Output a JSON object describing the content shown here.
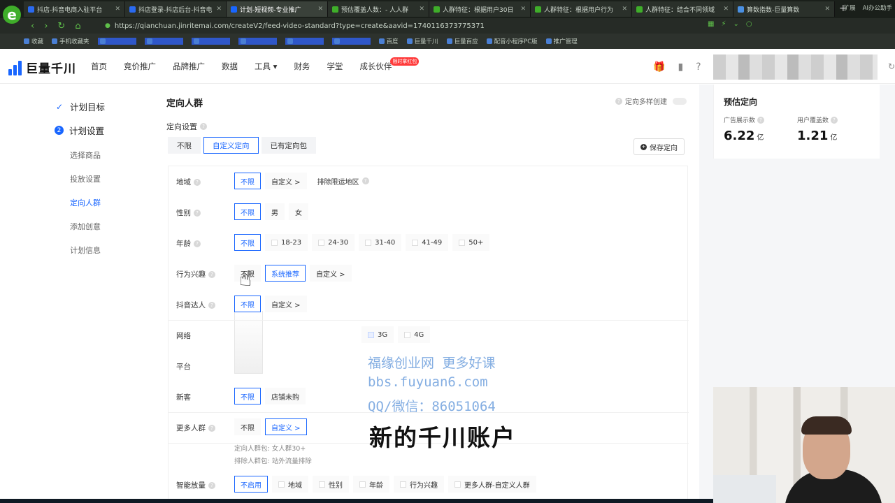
{
  "browser": {
    "tabs": [
      {
        "label": "抖店-抖音电商入驻平台",
        "color": "#2a6af0",
        "active": false
      },
      {
        "label": "抖店登录-抖店后台-抖音电",
        "color": "#2a6af0",
        "active": false
      },
      {
        "label": "计划-短视频-专业推广",
        "color": "#1966ff",
        "active": true
      },
      {
        "label": "预估覆盖人数：- 人人群",
        "color": "#3fae2a",
        "active": false
      },
      {
        "label": "人群特征：根据用户30日",
        "color": "#3fae2a",
        "active": false
      },
      {
        "label": "人群特征：根据用户行为",
        "color": "#3fae2a",
        "active": false
      },
      {
        "label": "人群特征：结合不同领域",
        "color": "#3fae2a",
        "active": false
      },
      {
        "label": "算数指数-巨量算数",
        "color": "#4a90e2",
        "active": false
      }
    ],
    "url": "https://qianchuan.jinritemai.com/createV2/feed-video-standard?type=create&aavid=1740116373775371",
    "bookmarks": [
      {
        "label": "收藏",
        "blue": false
      },
      {
        "label": "手机收藏夹",
        "blue": false
      },
      {
        "label": "",
        "blue": true
      },
      {
        "label": "",
        "blue": true
      },
      {
        "label": "",
        "blue": true
      },
      {
        "label": "",
        "blue": true
      },
      {
        "label": "",
        "blue": true
      },
      {
        "label": "",
        "blue": true
      },
      {
        "label": "百度",
        "blue": false
      },
      {
        "label": "巨量千川",
        "blue": false
      },
      {
        "label": "巨量百应",
        "blue": false
      },
      {
        "label": "配音小程序PC版",
        "blue": false
      },
      {
        "label": "推广管理",
        "blue": false
      }
    ],
    "bookmarks_right": [
      "扩展",
      "AI办公助手"
    ]
  },
  "app": {
    "brand": "巨量千川",
    "nav": [
      "首页",
      "竞价推广",
      "品牌推广",
      "数据",
      "工具 ▾",
      "财务",
      "学堂",
      "成长伙伴"
    ],
    "nav_badge": "限时拿红包"
  },
  "steps": {
    "done": "计划目标",
    "current_num": "2",
    "current": "计划设置",
    "subs": [
      {
        "label": "选择商品",
        "active": false
      },
      {
        "label": "投放设置",
        "active": false
      },
      {
        "label": "定向人群",
        "active": true
      },
      {
        "label": "添加创意",
        "active": false
      },
      {
        "label": "计划信息",
        "active": false
      }
    ]
  },
  "form": {
    "title": "定向人群",
    "multi_create": "定向多样创建",
    "setting_label": "定向设置",
    "segments": [
      {
        "label": "不限",
        "selected": false
      },
      {
        "label": "自定义定向",
        "selected": true
      },
      {
        "label": "已有定向包",
        "selected": false
      }
    ],
    "save_label": "保存定向",
    "rows": [
      {
        "label": "地域",
        "help": true,
        "options": [
          {
            "text": "不限",
            "style": "sel"
          },
          {
            "text": "自定义 >",
            "style": ""
          },
          {
            "text": "排除限运地区",
            "style": "plain",
            "help": true
          }
        ]
      },
      {
        "label": "性别",
        "help": true,
        "options": [
          {
            "text": "不限",
            "style": "sel"
          },
          {
            "text": "男",
            "style": ""
          },
          {
            "text": "女",
            "style": ""
          }
        ]
      },
      {
        "label": "年龄",
        "help": true,
        "options": [
          {
            "text": "不限",
            "style": "sel"
          },
          {
            "text": "18-23",
            "style": "cb"
          },
          {
            "text": "24-30",
            "style": "cb"
          },
          {
            "text": "31-40",
            "style": "cb"
          },
          {
            "text": "41-49",
            "style": "cb"
          },
          {
            "text": "50+",
            "style": "cb"
          }
        ]
      },
      {
        "label": "行为兴趣",
        "help": true,
        "options": [
          {
            "text": "不限",
            "style": ""
          },
          {
            "text": "系统推荐",
            "style": "bsel"
          },
          {
            "text": "自定义 >",
            "style": ""
          }
        ]
      },
      {
        "label": "抖音达人",
        "help": true,
        "options": [
          {
            "text": "不限",
            "style": "sel"
          },
          {
            "text": "自定义 >",
            "style": ""
          }
        ]
      },
      {
        "label": "网络",
        "help": false,
        "options": [
          {
            "text": "3G",
            "style": "cbon"
          },
          {
            "text": "4G",
            "style": "cb"
          }
        ]
      },
      {
        "label": "平台",
        "help": false,
        "options": []
      },
      {
        "label": "新客",
        "help": false,
        "options": [
          {
            "text": "不限",
            "style": "sel"
          },
          {
            "text": "店铺未购",
            "style": ""
          }
        ]
      },
      {
        "label": "更多人群",
        "help": true,
        "options": [
          {
            "text": "不限",
            "style": ""
          },
          {
            "text": "自定义 >",
            "style": "bsel"
          }
        ]
      },
      {
        "label": "智能放量",
        "help": true,
        "options": [
          {
            "text": "不启用",
            "style": "sel"
          },
          {
            "text": "地域",
            "style": "cb"
          },
          {
            "text": "性别",
            "style": "cb"
          },
          {
            "text": "年龄",
            "style": "cb"
          },
          {
            "text": "行为兴趣",
            "style": "cb"
          },
          {
            "text": "更多人群-自定义人群",
            "style": "cb"
          }
        ]
      }
    ],
    "more_notes": [
      "定向人群包:  女人群30+",
      "排除人群包:  站外流量排除"
    ]
  },
  "estimate": {
    "title": "预估定向",
    "items": [
      {
        "label": "广告展示数",
        "value": "6.22",
        "unit": "亿"
      },
      {
        "label": "用户覆盖数",
        "value": "1.21",
        "unit": "亿"
      }
    ]
  },
  "overlay": {
    "watermark_lines": [
      "福缘创业网 更多好课",
      "bbs.fuyuan6.com",
      "QQ/微信：86051064"
    ],
    "caption": "新的千川账户"
  }
}
